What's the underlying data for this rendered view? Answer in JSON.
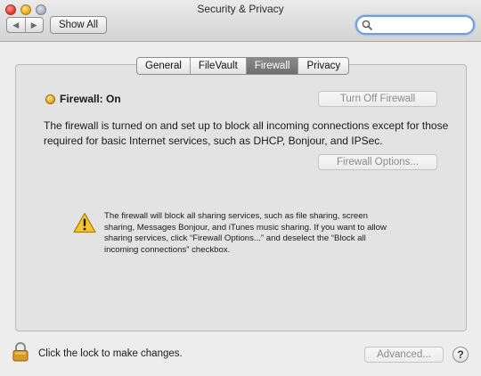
{
  "window": {
    "title": "Security & Privacy"
  },
  "toolbar": {
    "back_glyph": "◀",
    "forward_glyph": "▶",
    "show_all_label": "Show All",
    "search_value": ""
  },
  "tabs": [
    {
      "label": "General"
    },
    {
      "label": "FileVault"
    },
    {
      "label": "Firewall",
      "selected": true
    },
    {
      "label": "Privacy"
    }
  ],
  "firewall": {
    "status_label": "Firewall: On",
    "status_color": "#e3a824",
    "turn_off_label": "Turn Off Firewall",
    "description": "The firewall is turned on and set up to block all incoming connections except for those required for basic Internet services, such as DHCP, Bonjour, and IPSec.",
    "options_label": "Firewall Options...",
    "warning_icon": "warning-triangle-icon",
    "warning_text": "The firewall will block all sharing services, such as file sharing, screen sharing, Messages Bonjour, and iTunes music sharing.  If you want to allow sharing services, click “Firewall Options...” and deselect the “Block all incoming connections” checkbox."
  },
  "footer": {
    "lock_icon": "padlock-icon",
    "lock_text": "Click the lock to make changes.",
    "advanced_label": "Advanced...",
    "help_label": "?"
  },
  "colors": {
    "accent": "#6b9fe0",
    "selected_tab": "#7a7a7a"
  }
}
